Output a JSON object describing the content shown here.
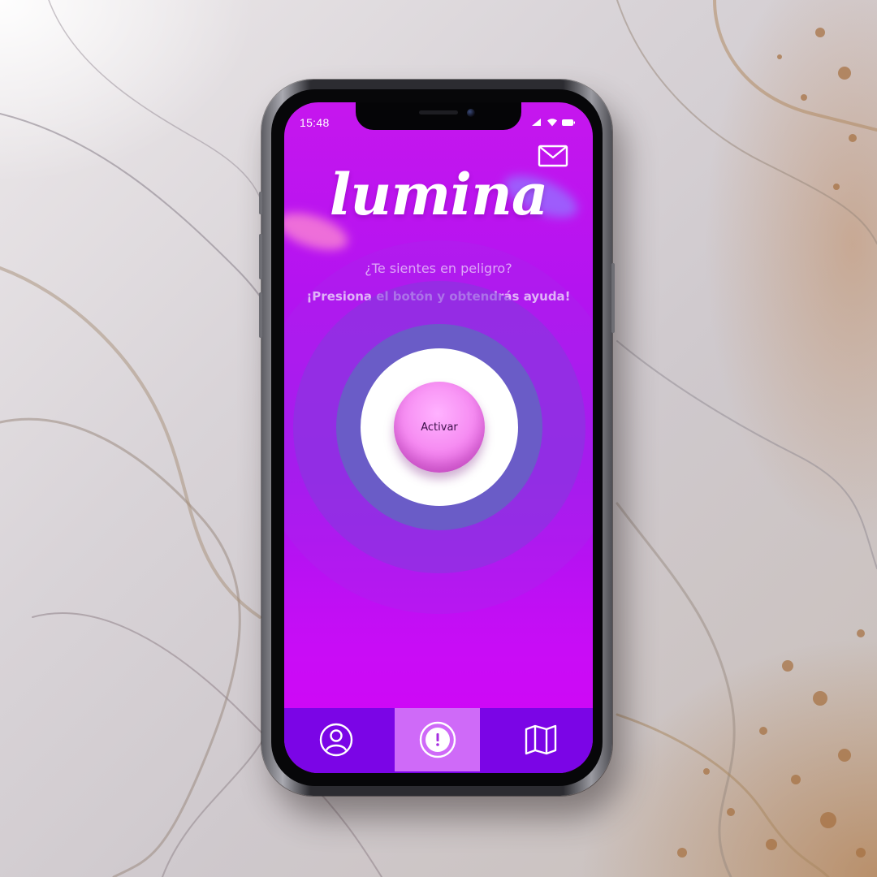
{
  "status_bar": {
    "time": "15:48",
    "icons": [
      "signal-icon",
      "wifi-icon",
      "battery-icon"
    ]
  },
  "header": {
    "mail_icon": "mail-icon"
  },
  "app": {
    "logo_text": "lumina",
    "question": "¿Te sientes en peligro?",
    "instruction": "¡Presiona el botón y obtendrás ayuda!",
    "activate_label": "Activar"
  },
  "tabbar": {
    "items": [
      {
        "icon": "profile-icon",
        "active": false
      },
      {
        "icon": "alert-icon",
        "active": true
      },
      {
        "icon": "map-icon",
        "active": false
      }
    ]
  },
  "colors": {
    "screen_top": "#c616ee",
    "screen_bottom": "#d304f7",
    "tabbar": "#7b05e6",
    "active_tab": "#cf6af8",
    "button_pink": "#f68cf2",
    "ring_blue": "#6a5cc7"
  }
}
